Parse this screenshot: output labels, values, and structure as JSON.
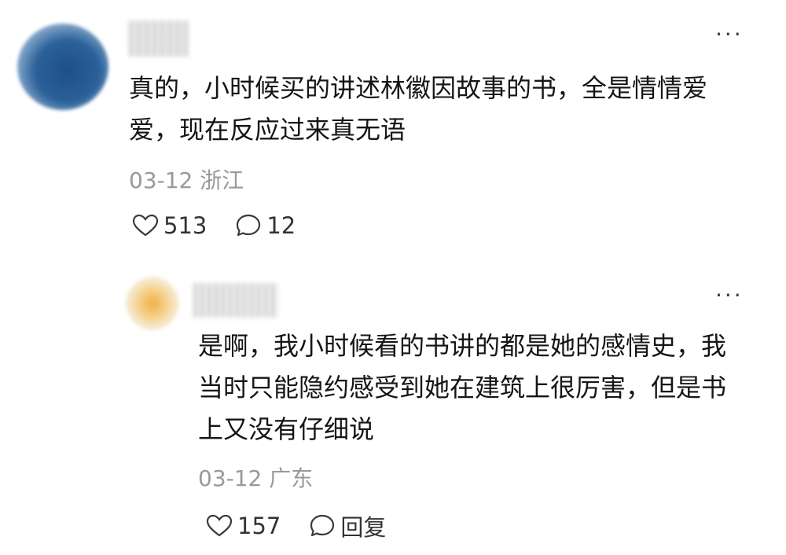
{
  "comments": [
    {
      "text": "真的，小时候买的讲述林徽因故事的书，全是情情爱爱，现在反应过来真无语",
      "date": "03-12",
      "location": "浙江",
      "likes": "513",
      "replies": "12"
    },
    {
      "text": "是啊，我小时候看的书讲的都是她的感情史，我当时只能隐约感受到她在建筑上很厉害，但是书上又没有仔细说",
      "date": "03-12",
      "location": "广东",
      "likes": "157",
      "reply_label": "回复"
    }
  ],
  "more_label": "···",
  "icons": {
    "like": "heart-outline-icon",
    "comment": "speech-bubble-icon"
  }
}
